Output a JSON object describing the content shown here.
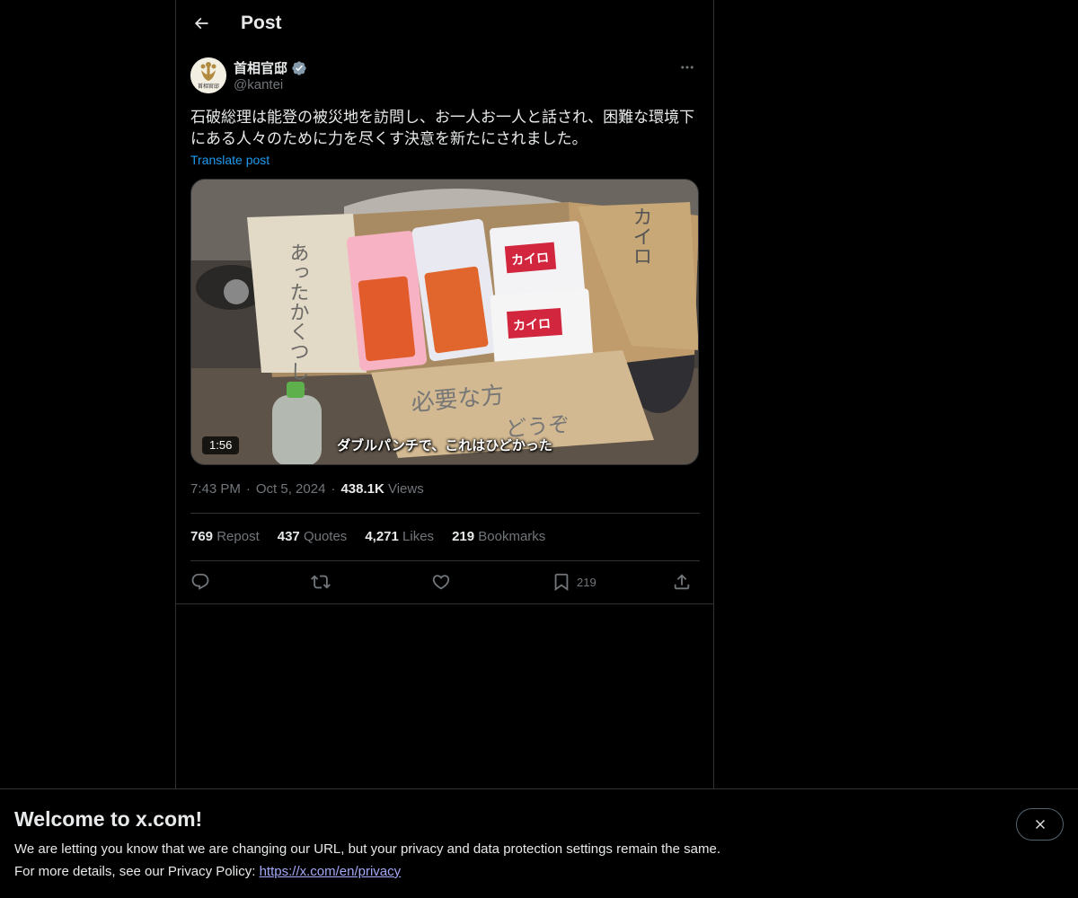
{
  "header": {
    "title": "Post"
  },
  "author": {
    "name": "首相官邸",
    "handle": "@kantei",
    "avatar_text": "首相官邸"
  },
  "post": {
    "text": "石破総理は能登の被災地を訪問し、お一人お一人と話され、困難な環境下にある人々のために力を尽くす決意を新たにされました。",
    "translate_label": "Translate post"
  },
  "media": {
    "duration": "1:56",
    "caption": "ダブルパンチで、これはひどかった",
    "sign_left": "あったかくつした",
    "sign_right": "カイロ",
    "sign_front_1": "必要な方",
    "sign_front_2": "どうぞ",
    "package_label_1": "カイロ",
    "package_label_2": "カイロ"
  },
  "meta": {
    "time": "7:43 PM",
    "date": "Oct 5, 2024",
    "views_count": "438.1K",
    "views_label": "Views",
    "separator": "·"
  },
  "stats": {
    "reposts_count": "769",
    "reposts_label": "Repost",
    "quotes_count": "437",
    "quotes_label": "Quotes",
    "likes_count": "4,271",
    "likes_label": "Likes",
    "bookmarks_count": "219",
    "bookmarks_label": "Bookmarks"
  },
  "actions": {
    "bookmark_count": "219"
  },
  "banner": {
    "title": "Welcome to x.com!",
    "line1": "We are letting you know that we are changing our URL, but your privacy and data protection settings remain the same.",
    "line2_prefix": "For more details, see our Privacy Policy: ",
    "link": "https://x.com/en/privacy"
  },
  "icons": {
    "back": "back-arrow-icon",
    "verified": "verified-badge-icon",
    "more": "more-dots-icon",
    "reply": "reply-icon",
    "repost": "repost-icon",
    "like": "like-icon",
    "bookmark": "bookmark-icon",
    "share": "share-icon",
    "close": "close-icon"
  },
  "colors": {
    "background": "#000000",
    "text": "#e7e9ea",
    "muted": "#71767b",
    "link": "#1d9bf0",
    "border": "#2f3336",
    "verified": "#829aab"
  }
}
